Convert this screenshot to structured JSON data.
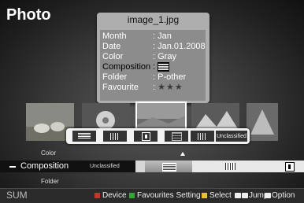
{
  "page": {
    "title": "Photo"
  },
  "info_card": {
    "filename": "image_1.jpg",
    "rows": [
      {
        "key": "Month",
        "value": ": Jan"
      },
      {
        "key": "Date",
        "value": ": Jan.01.2008"
      },
      {
        "key": "Color",
        "value": ": Gray"
      },
      {
        "key": "Composition",
        "value": ":"
      },
      {
        "key": "Folder",
        "value": ": P-other"
      },
      {
        "key": "Favourite",
        "value": ":"
      }
    ],
    "stars": "★★★"
  },
  "filter_bar": {
    "unclassified": "Unclassified"
  },
  "sort_menu": {
    "above": "Color",
    "current": "Composition",
    "below": "Folder",
    "row_label": "Unclassified"
  },
  "footer": {
    "sum": "SUM",
    "device": "Device",
    "favourites": "Favourites Setting",
    "select": "Select",
    "jump": "Jump",
    "option": "Option"
  },
  "colors": {
    "device_key": "#c8322b",
    "favourites_key": "#35a33a",
    "select_key": "#e8c22a"
  }
}
